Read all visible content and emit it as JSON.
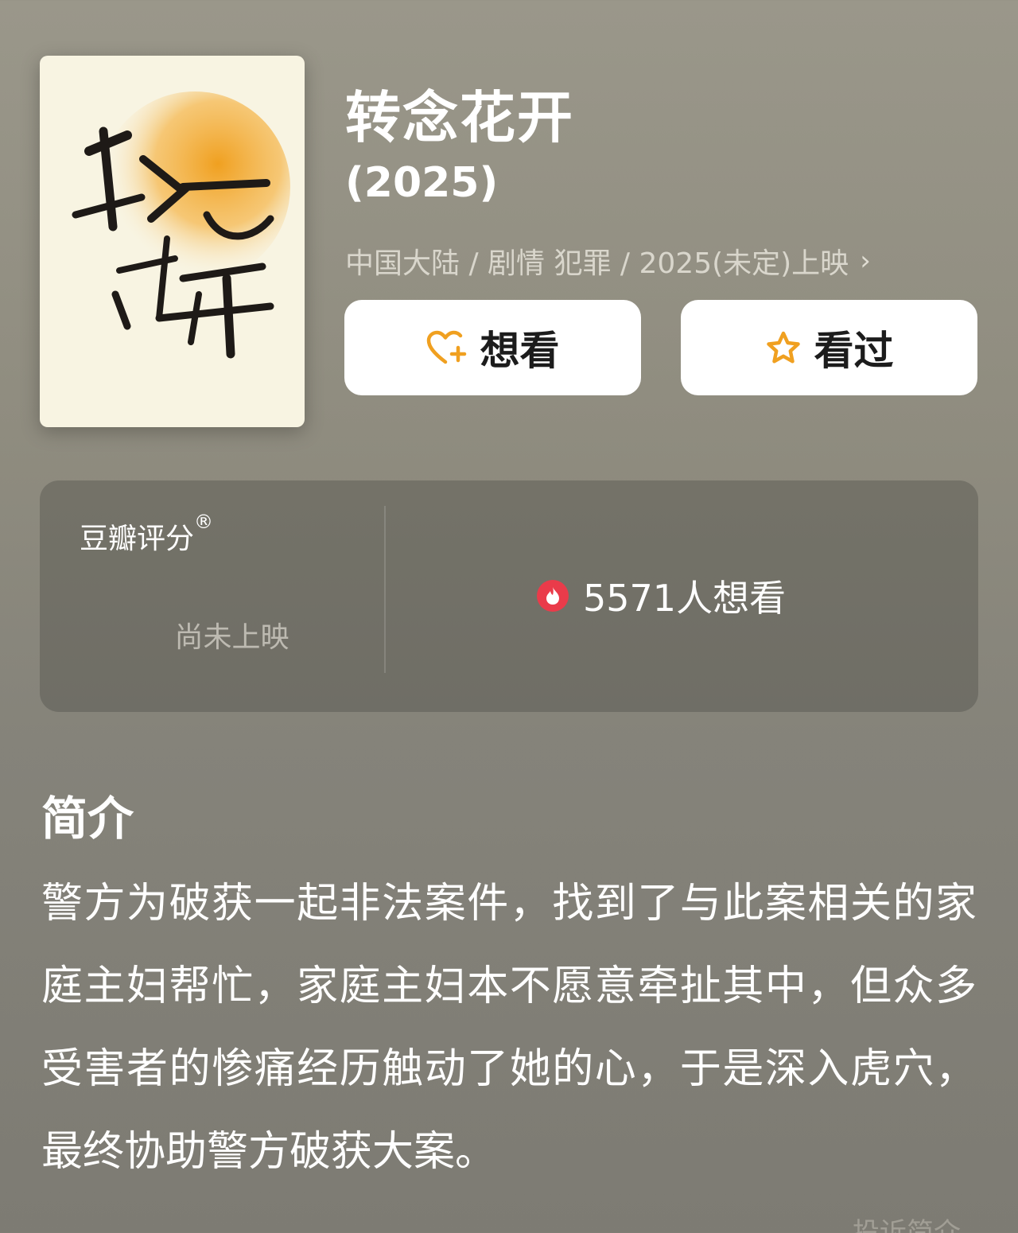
{
  "movie": {
    "title": "转念花开",
    "year": "(2025)",
    "poster_calligraphy": "转念花开",
    "meta": "中国大陆 / 剧情 犯罪 / 2025(未定)上映",
    "chevron": "›"
  },
  "actions": {
    "want_label": "想看",
    "seen_label": "看过"
  },
  "rating": {
    "label": "豆瓣评分",
    "registered": "®",
    "status": "尚未上映",
    "want_count": "5571人想看"
  },
  "intro": {
    "heading": "简介",
    "text": "警方为破获一起非法案件，找到了与此案相关的家庭主妇帮忙，家庭主妇本不愿意牵扯其中，但众多受害者的惨痛经历触动了她的心，于是深入虎穴，最终协助警方破获大案。",
    "report_link": "投诉简介"
  },
  "colors": {
    "accent_orange": "#f0a020",
    "flame_red": "#ea3b4a"
  }
}
